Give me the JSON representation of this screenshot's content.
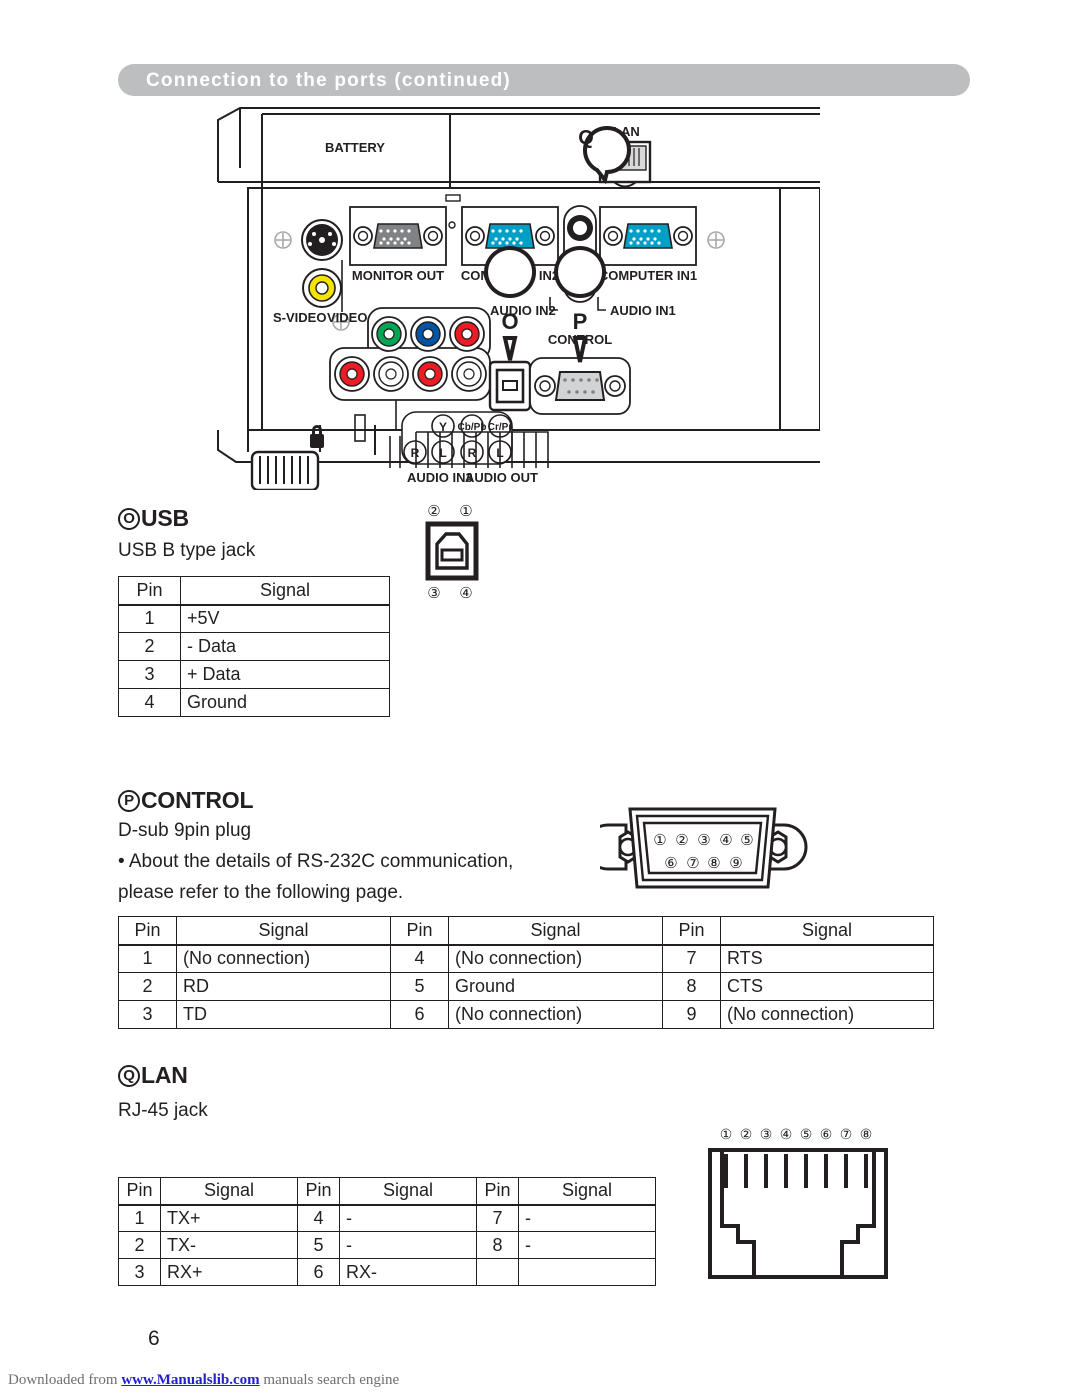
{
  "header": {
    "title": "Connection to the ports (continued)"
  },
  "diagram": {
    "name": "projector-rear-ports-illustration",
    "labels": {
      "battery": "BATTERY",
      "lan": "LAN",
      "monitor_out": "MONITOR OUT",
      "computer_in2": "COMPUTER IN2",
      "computer_in1": "COMPUTER IN1",
      "audio_in2": "AUDIO IN2",
      "audio_in1": "AUDIO IN1",
      "s_video": "S-VIDEO",
      "video": "VIDEO",
      "control": "CONTROL",
      "audio_in3": "AUDIO IN3",
      "audio_out": "AUDIO OUT",
      "y": "Y",
      "cb_pb": "Cb/Pb",
      "cr_pr": "Cr/Pr",
      "r1": "R",
      "l1": "L",
      "r2": "R",
      "l2": "L"
    },
    "callouts": {
      "o": "O",
      "p": "P",
      "q": "Q"
    },
    "colors": {
      "vga_blue": "#00a0c6",
      "vga_grey": "#808285",
      "video_yellow": "#f2e500",
      "comp_green": "#00a651",
      "comp_blue": "#0054a6",
      "comp_red": "#ed1c24",
      "audio_red": "#ed1c24"
    }
  },
  "usb": {
    "callout": "O",
    "title": "USB",
    "subtitle": "USB B type jack",
    "connector": {
      "name": "usb-b-jack-pinout",
      "top_pins": [
        "2",
        "1"
      ],
      "bottom_pins": [
        "3",
        "4"
      ]
    },
    "table": {
      "headers": [
        "Pin",
        "Signal"
      ],
      "rows": [
        [
          "1",
          "+5V"
        ],
        [
          "2",
          "- Data"
        ],
        [
          "3",
          "+ Data"
        ],
        [
          "4",
          "Ground"
        ]
      ]
    }
  },
  "control": {
    "callout": "P",
    "title": "CONTROL",
    "subtitle": "D-sub 9pin plug",
    "note_line1": "• About the details of RS-232C communication,",
    "note_line2": "please refer to the following page.",
    "connector": {
      "name": "dsub-9pin-plug-pinout",
      "top_pins": [
        "1",
        "2",
        "3",
        "4",
        "5"
      ],
      "bottom_pins": [
        "6",
        "7",
        "8",
        "9"
      ]
    },
    "table": {
      "headers": [
        "Pin",
        "Signal",
        "Pin",
        "Signal",
        "Pin",
        "Signal"
      ],
      "rows": [
        [
          "1",
          "(No connection)",
          "4",
          "(No connection)",
          "7",
          "RTS"
        ],
        [
          "2",
          "RD",
          "5",
          "Ground",
          "8",
          "CTS"
        ],
        [
          "3",
          "TD",
          "6",
          "(No connection)",
          "9",
          "(No connection)"
        ]
      ]
    }
  },
  "lan": {
    "callout": "Q",
    "title": "LAN",
    "subtitle": "RJ-45 jack",
    "connector": {
      "name": "rj45-jack-pinout",
      "pins": [
        "1",
        "2",
        "3",
        "4",
        "5",
        "6",
        "7",
        "8"
      ]
    },
    "table": {
      "headers": [
        "Pin",
        "Signal",
        "Pin",
        "Signal",
        "Pin",
        "Signal"
      ],
      "rows": [
        [
          "1",
          "TX+",
          "4",
          "-",
          "7",
          "-"
        ],
        [
          "2",
          "TX-",
          "5",
          "-",
          "8",
          "-"
        ],
        [
          "3",
          "RX+",
          "6",
          "RX-",
          "",
          ""
        ]
      ]
    }
  },
  "footer": {
    "page_number": "6",
    "download_prefix": "Downloaded from ",
    "download_link": "www.Manualslib.com",
    "download_suffix": " manuals search engine"
  }
}
